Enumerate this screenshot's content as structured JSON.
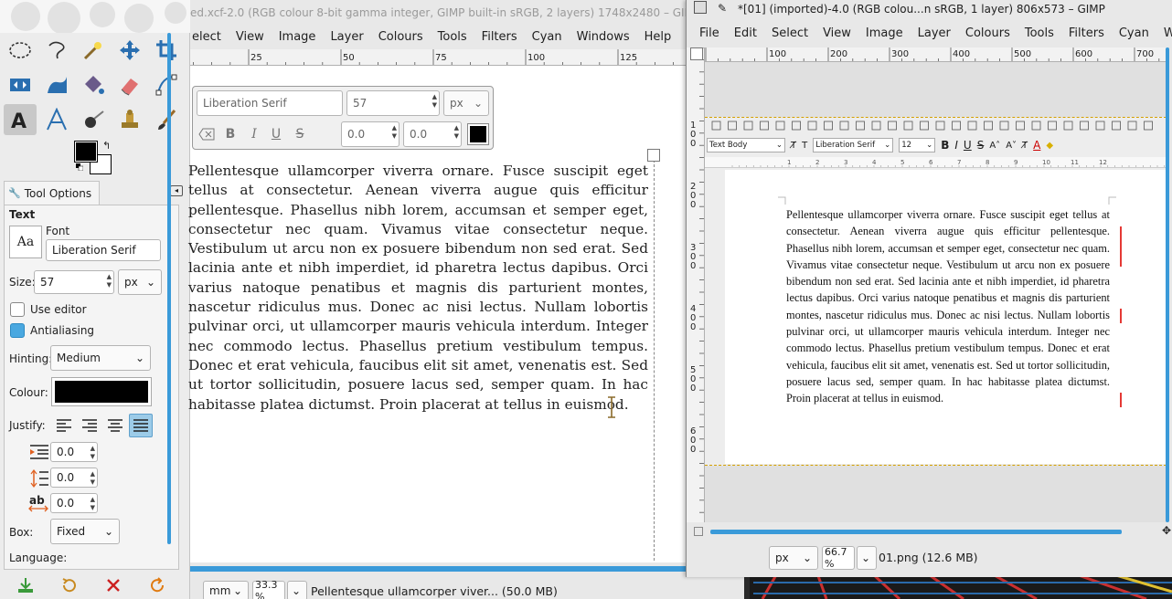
{
  "toolbox": {
    "tools": [
      "ellipse-select-icon",
      "free-select-icon",
      "fuzzy-select-icon",
      "move-icon",
      "crop-icon",
      "flip-icon",
      "warp-icon",
      "bucket-fill-icon",
      "eraser-icon",
      "path-icon",
      "text-icon",
      "measure-icon",
      "airbrush-icon",
      "clone-icon",
      "paintbrush-icon"
    ],
    "colors": {
      "fg": "#000000",
      "bg": "#ffffff"
    },
    "dock_tab_label": "Tool Options",
    "options": {
      "title": "Text",
      "font_label": "Font",
      "font_value": "Liberation Serif",
      "size_label": "Size:",
      "size_value": "57",
      "size_unit": "px",
      "use_editor": "Use editor",
      "antialiasing": "Antialiasing",
      "hinting_label": "Hinting:",
      "hinting_value": "Medium",
      "colour_label": "Colour:",
      "colour_value": "#000000",
      "justify_label": "Justify:",
      "indent_value": "0.0",
      "line_spacing_value": "0.0",
      "letter_spacing_value": "0.0",
      "box_label": "Box:",
      "box_value": "Fixed",
      "language_label": "Language:"
    }
  },
  "main": {
    "title": "ed.xcf-2.0 (RGB colour 8-bit gamma integer, GIMP built-in sRGB, 2 layers) 1748x2480 – GIMP",
    "menu": [
      "elect",
      "View",
      "Image",
      "Layer",
      "Colours",
      "Tools",
      "Filters",
      "Cyan",
      "Windows",
      "Help"
    ],
    "ruler_ticks": [
      "25",
      "50",
      "75",
      "100",
      "125"
    ],
    "text_toolbar": {
      "font": "Liberation Serif",
      "size": "57",
      "unit": "px",
      "baseline": "0.0",
      "kerning": "0.0"
    },
    "body_text": "Pellentesque ullamcorper viverra ornare. Fusce suscipit eget tellus at consectetur. Aenean viverra augue quis efficitur pellentesque. Phasellus nibh lorem, accumsan et semper eget, consectetur nec quam. Vivamus vitae consectetur neque. Vestibulum ut arcu non ex posuere bibendum non sed erat. Sed lacinia ante et nibh imperdiet, id pharetra lectus dapibus. Orci varius natoque penatibus et magnis dis parturient montes, nascetur ridiculus mus. Donec ac nisi lectus. Nullam lobortis pulvinar orci, ut ullamcorper mauris vehicula interdum. Integer nec commodo lectus. Phasellus pretium vestibulum tempus. Donec et erat vehicula, faucibus elit sit amet, venenatis est. Sed ut tortor sollicitudin, posuere lacus sed, semper quam. In hac habitasse platea dictumst. Proin placerat at tellus in euismod.",
    "status": {
      "unit": "mm",
      "zoom": "33.3 %",
      "layer": "Pellentesque ullamcorper viver... (50.0 MB)"
    }
  },
  "right": {
    "title": "*[01] (imported)-4.0 (RGB colou...n sRGB, 1 layer) 806x573 – GIMP",
    "menu": [
      "File",
      "Edit",
      "Select",
      "View",
      "Image",
      "Layer",
      "Colours",
      "Tools",
      "Filters",
      "Cyan",
      "Window"
    ],
    "ruler_ticks": [
      "100",
      "200",
      "300",
      "400",
      "500",
      "600",
      "700"
    ],
    "vruler_ticks": [
      "100",
      "200",
      "300",
      "400",
      "500",
      "600"
    ],
    "lo": {
      "style": "Text Body",
      "font": "Liberation Serif",
      "size": "12",
      "ruler_nums": [
        "1",
        "2",
        "3",
        "4",
        "5",
        "6",
        "7",
        "8",
        "9",
        "10",
        "11",
        "12"
      ]
    },
    "body_text": "Pellentesque ullamcorper viverra ornare. Fusce suscipit eget tellus at consectetur. Aenean viverra augue quis efficitur pel­lentesque. Phasellus nibh lorem, accumsan et semper eget, con­sectetur nec quam. Vivamus vitae consectetur neque. Vestibu­lum ut arcu non ex posuere bibendum non sed erat. Sed lacinia ante et nibh imperdiet, id pharetra lectus dapibus. Orci varius natoque penatibus et magnis dis parturient montes, nascetur ri­diculus mus. Donec ac nisi lectus. Nullam lobortis pulvinar orci, ut ullamcorper mauris vehicula interdum. Integer nec commodo lectus. Phasellus pretium vestibulum tempus. Donec et erat vehicula, faucibus elit sit amet, venenatis est. Sed ut tortor sollicitudin, posuere lacus sed, semper quam. In hac hab­itasse platea dictumst. Proin placerat at tellus in euismod.",
    "status": {
      "unit": "px",
      "zoom": "66.7 %",
      "file": "01.png (12.6 MB)"
    }
  }
}
